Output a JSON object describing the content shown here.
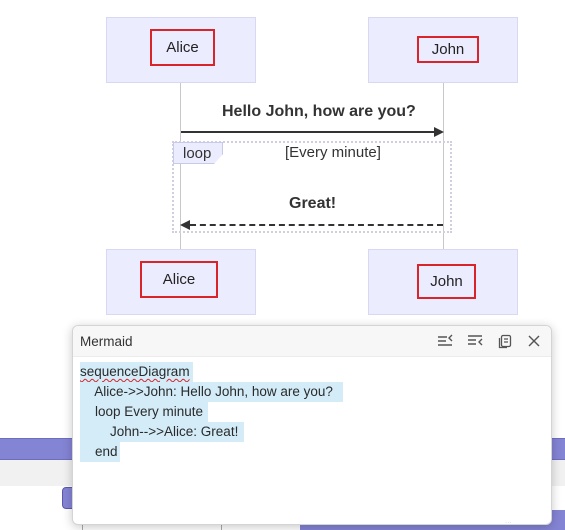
{
  "diagram": {
    "actors_top": [
      "Alice",
      "John"
    ],
    "actors_bottom": [
      "Alice",
      "John"
    ],
    "message_1": "Hello John, how are you?",
    "loop_label": "loop",
    "loop_condition": "[Every minute]",
    "message_2": "Great!"
  },
  "panel": {
    "title": "Mermaid",
    "icons": [
      "collapse-left-icon",
      "collapse-right-icon",
      "copy-icon",
      "close-icon"
    ],
    "code_lines": [
      "sequenceDiagram",
      "    Alice->>John: Hello John, how are you?",
      "    loop Every minute",
      "        John-->>Alice: Great!",
      "    end"
    ]
  },
  "background": {
    "watermark": "..."
  },
  "colors": {
    "actor_fill": "#ececff",
    "highlight_border": "#d9242b",
    "band": "#8484d4",
    "code_selection": "#d3ecf8"
  }
}
